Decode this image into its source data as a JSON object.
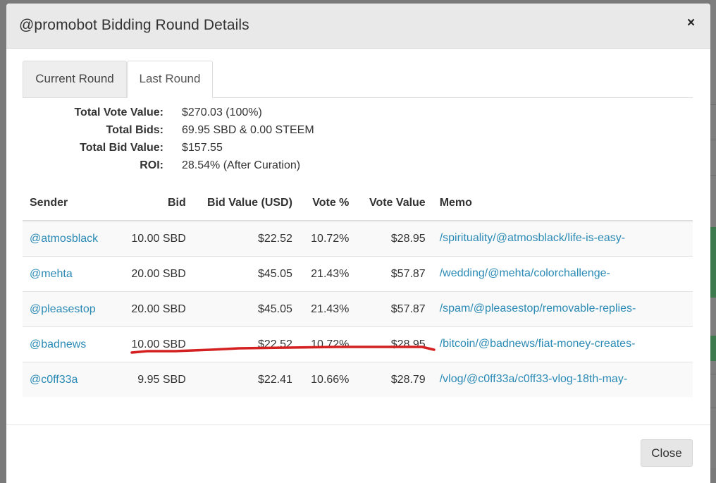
{
  "modal": {
    "title": "@promobot Bidding Round Details",
    "close_symbol": "×",
    "close_button_label": "Close"
  },
  "tabs": [
    {
      "label": "Current Round",
      "active": false
    },
    {
      "label": "Last Round",
      "active": true
    }
  ],
  "summary": [
    {
      "label": "Total Vote Value:",
      "value": "$270.03 (100%)"
    },
    {
      "label": "Total Bids:",
      "value": "69.95 SBD & 0.00 STEEM"
    },
    {
      "label": "Total Bid Value:",
      "value": "$157.55"
    },
    {
      "label": "ROI:",
      "value": "28.54% (After Curation)"
    }
  ],
  "table": {
    "headers": [
      "Sender",
      "Bid",
      "Bid Value (USD)",
      "Vote %",
      "Vote Value",
      "Memo"
    ],
    "rows": [
      {
        "sender": "@atmosblack",
        "bid": "10.00 SBD",
        "bid_value": "$22.52",
        "vote_pct": "10.72%",
        "vote_value": "$28.95",
        "memo": "/spirituality/@atmosblack/life-is-easy-"
      },
      {
        "sender": "@mehta",
        "bid": "20.00 SBD",
        "bid_value": "$45.05",
        "vote_pct": "21.43%",
        "vote_value": "$57.87",
        "memo": "/wedding/@mehta/colorchallenge-"
      },
      {
        "sender": "@pleasestop",
        "bid": "20.00 SBD",
        "bid_value": "$45.05",
        "vote_pct": "21.43%",
        "vote_value": "$57.87",
        "memo": "/spam/@pleasestop/removable-replies-"
      },
      {
        "sender": "@badnews",
        "bid": "10.00 SBD",
        "bid_value": "$22.52",
        "vote_pct": "10.72%",
        "vote_value": "$28.95",
        "memo": "/bitcoin/@badnews/fiat-money-creates-"
      },
      {
        "sender": "@c0ff33a",
        "bid": "9.95 SBD",
        "bid_value": "$22.41",
        "vote_pct": "10.66%",
        "vote_value": "$28.79",
        "memo": "/vlog/@c0ff33a/c0ff33-vlog-18th-may-"
      }
    ]
  },
  "colors": {
    "link": "#2a8ab5",
    "annotation_underline": "#d42020",
    "header_bg": "#e9e9e9"
  }
}
